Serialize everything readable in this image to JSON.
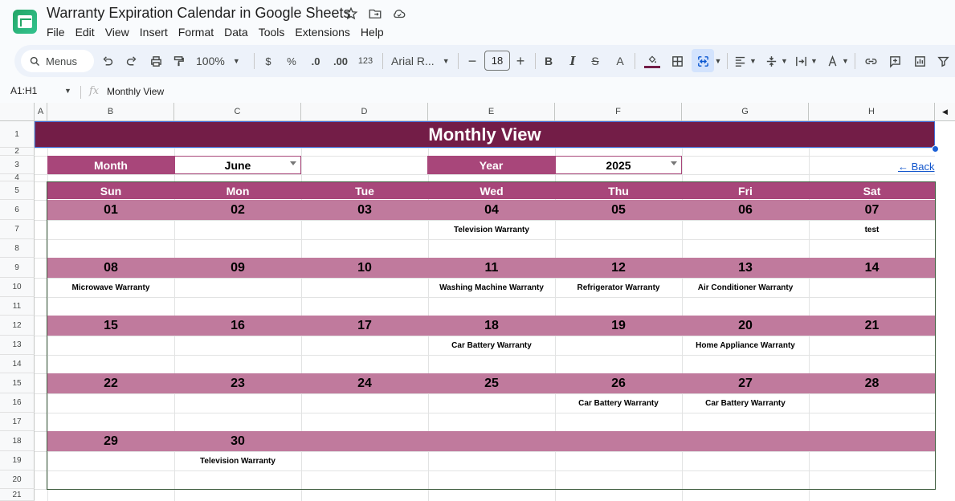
{
  "app": {
    "title": "Warranty Expiration Calendar in Google Sheets",
    "menu": [
      "File",
      "Edit",
      "View",
      "Insert",
      "Format",
      "Data",
      "Tools",
      "Extensions",
      "Help"
    ]
  },
  "toolbar": {
    "search_label": "Menus",
    "zoom": "100%",
    "currency": "$",
    "percent": "%",
    "dec_decrease": ".0",
    "dec_increase": ".00",
    "number_format": "123",
    "font": "Arial R...",
    "font_size": "18"
  },
  "formula_bar": {
    "name_box": "A1:H1",
    "fx": "fx",
    "content": "Monthly View"
  },
  "columns": [
    "A",
    "B",
    "C",
    "D",
    "E",
    "F",
    "G",
    "H"
  ],
  "rows": [
    "1",
    "2",
    "3",
    "4",
    "5",
    "6",
    "7",
    "8",
    "9",
    "10",
    "11",
    "12",
    "13",
    "14",
    "15",
    "16",
    "17",
    "18",
    "19",
    "20",
    "21"
  ],
  "sheet": {
    "title": "Monthly View",
    "month_label": "Month",
    "month_value": "June",
    "year_label": "Year",
    "year_value": "2025",
    "back_link": "← Back",
    "days_of_week": [
      "Sun",
      "Mon",
      "Tue",
      "Wed",
      "Thu",
      "Fri",
      "Sat"
    ],
    "weeks": [
      {
        "days": [
          "01",
          "02",
          "03",
          "04",
          "05",
          "06",
          "07"
        ],
        "events": [
          "",
          "",
          "",
          "Television Warranty",
          "",
          "",
          "test"
        ]
      },
      {
        "days": [
          "08",
          "09",
          "10",
          "11",
          "12",
          "13",
          "14"
        ],
        "events": [
          "Microwave Warranty",
          "",
          "",
          "Washing Machine Warranty",
          "Refrigerator Warranty",
          "Air Conditioner Warranty",
          ""
        ]
      },
      {
        "days": [
          "15",
          "16",
          "17",
          "18",
          "19",
          "20",
          "21"
        ],
        "events": [
          "",
          "",
          "",
          "Car Battery Warranty",
          "",
          "Home Appliance Warranty",
          ""
        ]
      },
      {
        "days": [
          "22",
          "23",
          "24",
          "25",
          "26",
          "27",
          "28"
        ],
        "events": [
          "",
          "",
          "",
          "",
          "Car Battery Warranty",
          "Car Battery Warranty",
          ""
        ]
      },
      {
        "days": [
          "29",
          "30",
          "",
          "",
          "",
          "",
          ""
        ],
        "events": [
          "",
          "Television Warranty",
          "",
          "",
          "",
          "",
          ""
        ]
      }
    ]
  },
  "colors": {
    "banner": "#731d47",
    "header": "#a8467a",
    "week_band": "#c07a9d"
  }
}
